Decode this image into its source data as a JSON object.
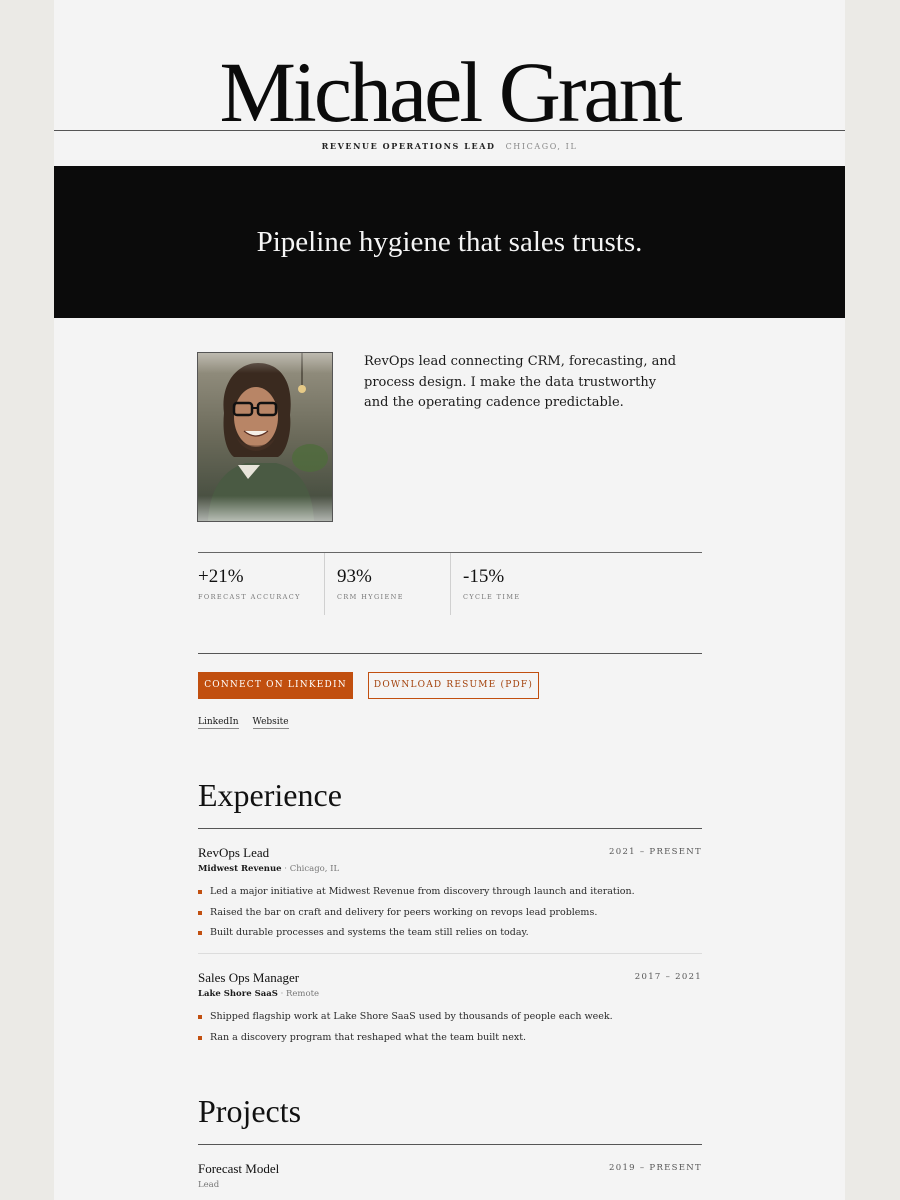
{
  "header": {
    "name": "Michael Grant",
    "role": "REVENUE OPERATIONS LEAD",
    "location": "CHICAGO, IL"
  },
  "hero": {
    "tagline": "Pipeline hygiene that sales trusts."
  },
  "about": {
    "bio": "RevOps lead connecting CRM, forecasting, and process design. I make the data trustworthy and the operating cadence predictable."
  },
  "stats": [
    {
      "value": "+21%",
      "label": "FORECAST ACCURACY"
    },
    {
      "value": "93%",
      "label": "CRM HYGIENE"
    },
    {
      "value": "-15%",
      "label": "CYCLE TIME"
    }
  ],
  "actions": {
    "primary_label": "CONNECT ON LINKEDIN",
    "secondary_label": "DOWNLOAD RESUME (PDF)"
  },
  "links": [
    "LinkedIn",
    "Website"
  ],
  "experience": {
    "title": "Experience",
    "jobs": [
      {
        "title": "RevOps Lead",
        "company": "Midwest Revenue",
        "separator": " · ",
        "location": "Chicago, IL",
        "dates": "2021 – PRESENT",
        "bullets": [
          "Led a major initiative at Midwest Revenue from discovery through launch and iteration.",
          "Raised the bar on craft and delivery for peers working on revops lead problems.",
          "Built durable processes and systems the team still relies on today."
        ]
      },
      {
        "title": "Sales Ops Manager",
        "company": "Lake Shore SaaS",
        "separator": " · ",
        "location": "Remote",
        "dates": "2017 – 2021",
        "bullets": [
          "Shipped flagship work at Lake Shore SaaS used by thousands of people each week.",
          "Ran a discovery program that reshaped what the team built next."
        ]
      }
    ]
  },
  "projects": {
    "title": "Projects",
    "items": [
      {
        "title": "Forecast Model",
        "role": "Lead",
        "dates": "2019 – PRESENT"
      }
    ]
  },
  "colors": {
    "accent": "#c14f0f",
    "hero_bg": "#0b0b0b",
    "page_bg": "#f4f4f4",
    "outer_bg": "#ebeae6"
  }
}
